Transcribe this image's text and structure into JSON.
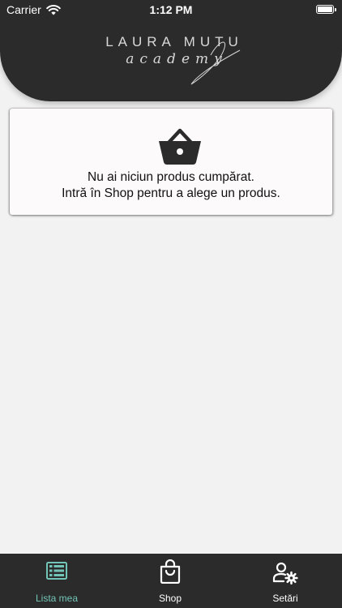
{
  "status_bar": {
    "carrier": "Carrier",
    "time": "1:12 PM"
  },
  "header": {
    "logo_text_top": "LAURA MUTU",
    "logo_text_bottom": "academy"
  },
  "empty_state": {
    "icon": "basket-icon",
    "line1": "Nu ai niciun produs cumpărat.",
    "line2": "Intră în Shop pentru a alege un produs."
  },
  "tab_bar": {
    "tabs": [
      {
        "label": "Lista mea",
        "icon": "list-icon",
        "active": true
      },
      {
        "label": "Shop",
        "icon": "shopping-bag-icon",
        "active": false
      },
      {
        "label": "Setări",
        "icon": "user-settings-icon",
        "active": false
      }
    ]
  },
  "colors": {
    "header_bg": "#2b2b2b",
    "page_bg": "#f2f2f2",
    "card_bg": "#fdfafc",
    "active_tab": "#72c4b6",
    "inactive_tab": "#ffffff"
  }
}
